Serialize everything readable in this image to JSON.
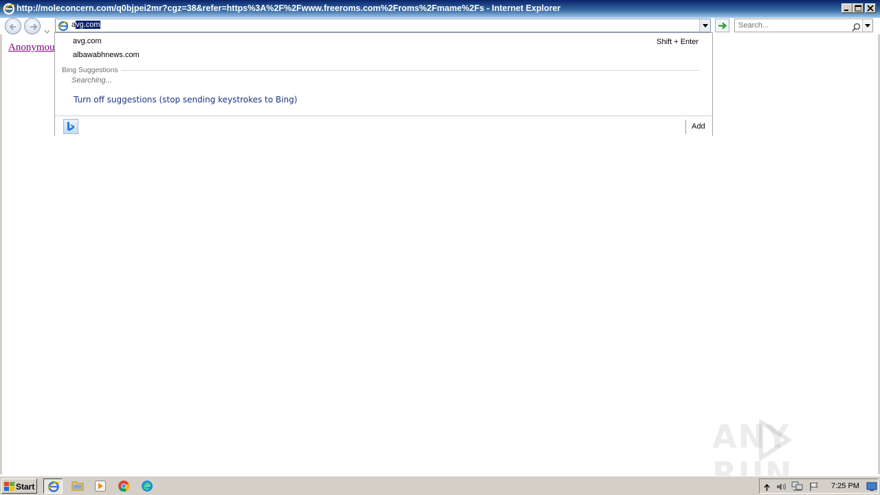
{
  "window": {
    "title": "http://moleconcern.com/q0bjpei2mr?cgz=38&refer=https%3A%2F%2Fwww.freeroms.com%2Froms%2Fmame%2Fs - Internet Explorer"
  },
  "address_bar": {
    "typed_prefix": "a",
    "selected_completion": "vg.com"
  },
  "search_box": {
    "placeholder": "Search..."
  },
  "page": {
    "link_text": "Anonymou"
  },
  "suggestions": {
    "history_items": [
      {
        "label": "avg.com"
      },
      {
        "label": "albawabhnews.com"
      }
    ],
    "shortcut_hint": "Shift + Enter",
    "bing_header": "Bing Suggestions",
    "status": "Searching...",
    "turn_off_label": "Turn off suggestions (stop sending keystrokes to Bing)",
    "add_label": "Add"
  },
  "taskbar": {
    "start_label": "Start",
    "clock": "7:25 PM"
  },
  "watermark": {
    "text_left": "ANY",
    "text_right": "RUN"
  },
  "icons": {
    "title": "ie-logo-icon",
    "nav": [
      "back-arrow-icon",
      "forward-arrow-icon",
      "chevron-down-icon"
    ],
    "search": "magnifier-icon",
    "go": "go-arrow-icon",
    "taskbar": [
      "windows-logo-icon",
      "ie-icon",
      "folder-icon",
      "media-player-icon",
      "chrome-icon",
      "edge-icon"
    ],
    "tray": [
      "up-chevron-icon",
      "speaker-icon",
      "network-icon",
      "flag-icon",
      "desktop-icon"
    ]
  },
  "colors": {
    "title_bar": "#0a246a",
    "selection": "#0a246a",
    "link_visited": "#800080",
    "suggestion_link": "#1a3380",
    "taskbar": "#d4d0c8"
  }
}
